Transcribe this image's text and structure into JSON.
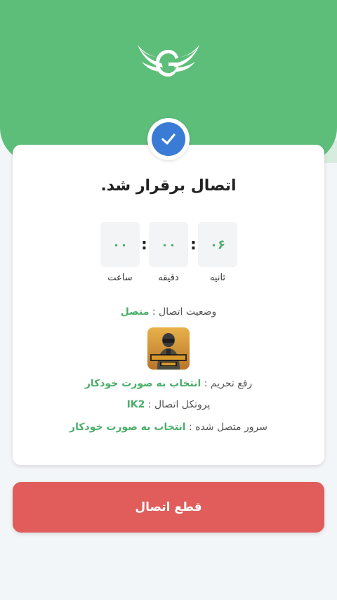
{
  "header": {
    "logo_icon": "winged-g-logo-icon"
  },
  "status": {
    "check_icon": "check-icon",
    "title": "اتصال برقرار شد."
  },
  "timer": {
    "seconds": "۰۶",
    "minutes": "۰۰",
    "hours": "۰۰",
    "seconds_label": "ثانیه",
    "minutes_label": "دقیقه",
    "hours_label": "ساعت",
    "separator": ":"
  },
  "details": {
    "connection_status_label": "وضعیت اتصال :",
    "connection_status_value": "متصل",
    "game_icon": "pubg-mobile-icon",
    "unblock_label": "رفع تحریم :",
    "unblock_value": "انتخاب به صورت خودکار",
    "protocol_label": "پروتکل اتصال :",
    "protocol_value": "IK2",
    "server_label": "سرور متصل شده :",
    "server_value": "انتخاب به صورت خودکار"
  },
  "actions": {
    "disconnect_label": "قطع اتصال"
  },
  "colors": {
    "header": "#5dbe7a",
    "accent_green": "#4cae6a",
    "check_blue": "#3a7bd5",
    "disconnect_red": "#e05d5b"
  }
}
